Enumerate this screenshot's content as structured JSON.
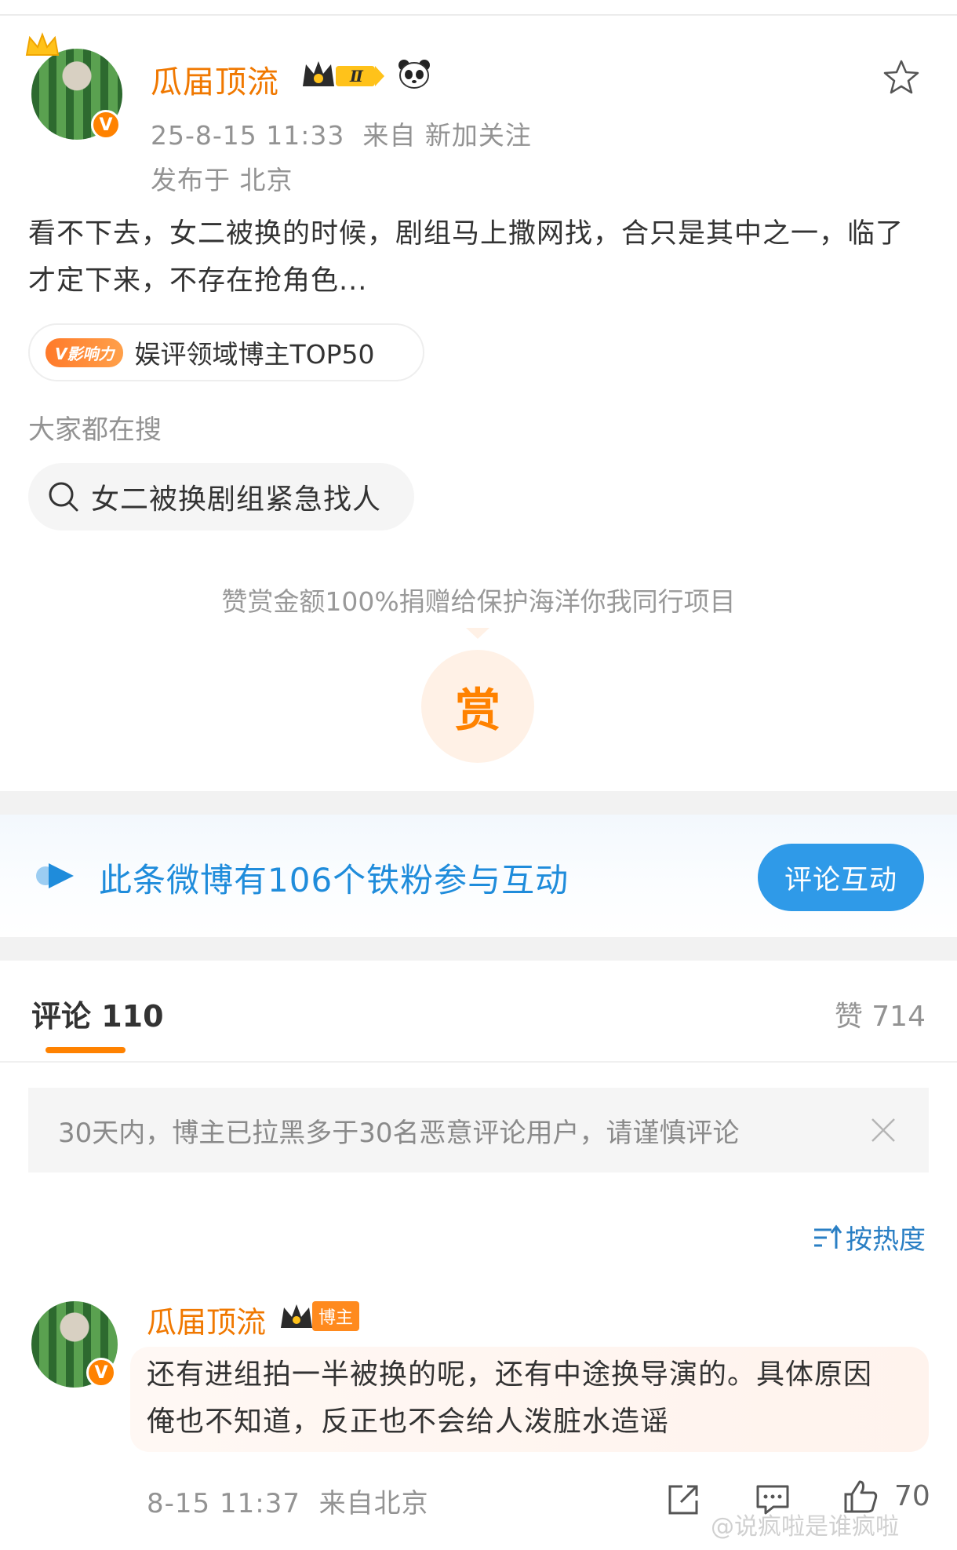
{
  "post": {
    "username": "瓜届顶流",
    "level_label": "Ⅱ",
    "timestamp": "25-8-15 11:33",
    "source": "来自 新加关注",
    "location": "发布于 北京",
    "body": "看不下去，女二被换的时候，剧组马上撒网找，合只是其中之一，临了才定下来，不存在抢角色...",
    "influence_badge": "V影响力",
    "influence_text": "娱评领域博主TOP50",
    "search_label": "大家都在搜",
    "search_chip": "女二被换剧组紧急找人",
    "reward_note": "赞赏金额100%捐赠给保护海洋你我同行项目",
    "reward_button": "赏"
  },
  "fans_banner": {
    "text": "此条微博有106个铁粉参与互动",
    "button": "评论互动"
  },
  "tabs": {
    "comments": "评论 110",
    "likes": "赞 714"
  },
  "notice": {
    "text": "30天内，博主已拉黑多于30名恶意评论用户，请谨慎评论"
  },
  "sort": {
    "label": "按热度"
  },
  "comment": {
    "username": "瓜届顶流",
    "author_badge": "博主",
    "text_line1": "还有进组拍一半被换的呢，还有中途换导演的。具体原因",
    "text_line2": "俺也不知道，反正也不会给人泼脏水造谣",
    "time": "8-15 11:37",
    "source": "来自北京",
    "likes": "70"
  },
  "watermark": "@说疯啦是谁疯啦",
  "colors": {
    "brand_orange": "#ff8200",
    "username_orange": "#f07800",
    "link_blue": "#1f8cdb",
    "button_blue": "#2f9ae8"
  },
  "icons": [
    "crown-icon",
    "verified-badge",
    "panda-icon",
    "star-icon",
    "search-icon",
    "fans-icon",
    "close-icon",
    "sort-icon",
    "share-icon",
    "comment-icon",
    "like-icon"
  ]
}
